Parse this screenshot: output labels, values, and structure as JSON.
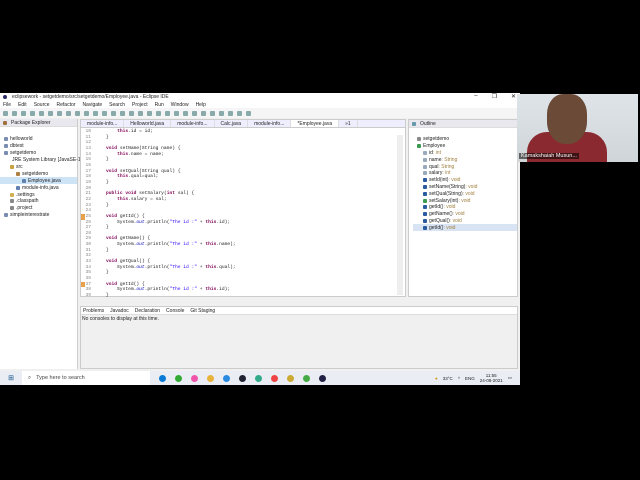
{
  "window": {
    "title": "eclipsework - setgetdemo/src/setgetdemo/Employee.java - Eclipse IDE",
    "minimize": "–",
    "maximize": "❐",
    "close": "✕"
  },
  "menu": [
    "File",
    "Edit",
    "Source",
    "Refactor",
    "Navigate",
    "Search",
    "Project",
    "Run",
    "Window",
    "Help"
  ],
  "package_explorer": {
    "title": "Package Explorer",
    "items": [
      {
        "label": "helloworld",
        "depth": 0,
        "color": "#7a8cb0"
      },
      {
        "label": "dbtest",
        "depth": 0,
        "color": "#7a8cb0"
      },
      {
        "label": "setgetdemo",
        "depth": 0,
        "color": "#7a8cb0"
      },
      {
        "label": "JRE System Library [JavaSE-1",
        "depth": 1,
        "color": "#9a7040"
      },
      {
        "label": "src",
        "depth": 1,
        "color": "#c8a040"
      },
      {
        "label": "setgetdemo",
        "depth": 2,
        "color": "#b08040"
      },
      {
        "label": "Employee.java",
        "depth": 3,
        "color": "#6080b0",
        "selected": true
      },
      {
        "label": "module-info.java",
        "depth": 2,
        "color": "#6080b0"
      },
      {
        "label": ".settings",
        "depth": 1,
        "color": "#d0b050"
      },
      {
        "label": ".classpath",
        "depth": 1,
        "color": "#888"
      },
      {
        "label": ".project",
        "depth": 1,
        "color": "#888"
      },
      {
        "label": "simpleinterestrate",
        "depth": 0,
        "color": "#7a8cb0"
      }
    ]
  },
  "editor": {
    "tabs": [
      {
        "label": "module-info..."
      },
      {
        "label": "Helloworld.java"
      },
      {
        "label": "module-info..."
      },
      {
        "label": "Calc.java"
      },
      {
        "label": "module-info..."
      },
      {
        "label": "*Employee.java",
        "active": true
      },
      {
        "label": "»1"
      }
    ],
    "lines": [
      {
        "n": "10",
        "t": "        this.id = id;"
      },
      {
        "n": "11",
        "t": "    }"
      },
      {
        "n": "12",
        "t": ""
      },
      {
        "n": "13",
        "t": "    void setName(String name) {"
      },
      {
        "n": "14",
        "t": "        this.name = name;"
      },
      {
        "n": "15",
        "t": "    }"
      },
      {
        "n": "16",
        "t": ""
      },
      {
        "n": "17",
        "t": "    void setQual(String qual) {"
      },
      {
        "n": "18",
        "t": "        this.qual=qual;"
      },
      {
        "n": "19",
        "t": "    }"
      },
      {
        "n": "20",
        "t": ""
      },
      {
        "n": "21",
        "t": "    public void setSalary(int sal) {"
      },
      {
        "n": "22",
        "t": "        this.salary = sal;"
      },
      {
        "n": "23",
        "t": "    }"
      },
      {
        "n": "24",
        "t": ""
      },
      {
        "n": "25",
        "t": "    void getId() {",
        "err": true
      },
      {
        "n": "26",
        "t": "        System.out.println(\"The id :\" + this.id);"
      },
      {
        "n": "27",
        "t": "    }"
      },
      {
        "n": "28",
        "t": ""
      },
      {
        "n": "29",
        "t": "    void getName() {"
      },
      {
        "n": "30",
        "t": "        System.out.println(\"The id :\" + this.name);"
      },
      {
        "n": "31",
        "t": "    }"
      },
      {
        "n": "32",
        "t": ""
      },
      {
        "n": "33",
        "t": "    void getQual() {"
      },
      {
        "n": "34",
        "t": "        System.out.println(\"The id :\" + this.qual);"
      },
      {
        "n": "35",
        "t": "    }"
      },
      {
        "n": "36",
        "t": ""
      },
      {
        "n": "37",
        "t": "    void getId() {",
        "err": true
      },
      {
        "n": "38",
        "t": "        System.out.println(\"The id :\" + this.id);"
      },
      {
        "n": "39",
        "t": "    }"
      }
    ]
  },
  "outline": {
    "title": "Outline",
    "items": [
      {
        "label": "setgetdemo",
        "type": "",
        "depth": 0,
        "color": "#888"
      },
      {
        "label": "Employee",
        "type": "",
        "depth": 0,
        "color": "#3a9a50"
      },
      {
        "label": "id",
        "type": " : int",
        "depth": 1,
        "color": "#9ab"
      },
      {
        "label": "name",
        "type": " : String",
        "depth": 1,
        "color": "#9ab"
      },
      {
        "label": "qual",
        "type": " : String",
        "depth": 1,
        "color": "#9ab"
      },
      {
        "label": "salary",
        "type": " : int",
        "depth": 1,
        "color": "#9ab"
      },
      {
        "label": "setId(int)",
        "type": " : void",
        "depth": 1,
        "color": "#2a5aa0"
      },
      {
        "label": "setName(String)",
        "type": " : void",
        "depth": 1,
        "color": "#2a5aa0"
      },
      {
        "label": "setQual(String)",
        "type": " : void",
        "depth": 1,
        "color": "#2a5aa0"
      },
      {
        "label": "setSalary(int)",
        "type": " : void",
        "depth": 1,
        "color": "#3a9a50"
      },
      {
        "label": "getId()",
        "type": " : void",
        "depth": 1,
        "color": "#2a5aa0"
      },
      {
        "label": "getName()",
        "type": " : void",
        "depth": 1,
        "color": "#2a5aa0"
      },
      {
        "label": "getQual()",
        "type": " : void",
        "depth": 1,
        "color": "#2a5aa0"
      },
      {
        "label": "getId()",
        "type": " : void",
        "depth": 1,
        "color": "#2a5aa0",
        "selected": true
      }
    ]
  },
  "bottom": {
    "tabs": [
      "Problems",
      "Javadoc",
      "Declaration",
      "Console",
      "Git Staging"
    ],
    "message": "No consoles to display at this time."
  },
  "taskbar": {
    "search_placeholder": "Type here to search",
    "weather": "33°C",
    "lang": "ENG",
    "time": "11:55",
    "date": "24-08-2021",
    "apps": [
      "#0a7ad6",
      "#3a3",
      "#e5a",
      "#e8b33a",
      "#2a8ae0",
      "#223",
      "#3a8",
      "#e44",
      "#ca3",
      "#4a4",
      "#224"
    ]
  },
  "webcam": {
    "name": "Kamakshaiah Musun..."
  }
}
